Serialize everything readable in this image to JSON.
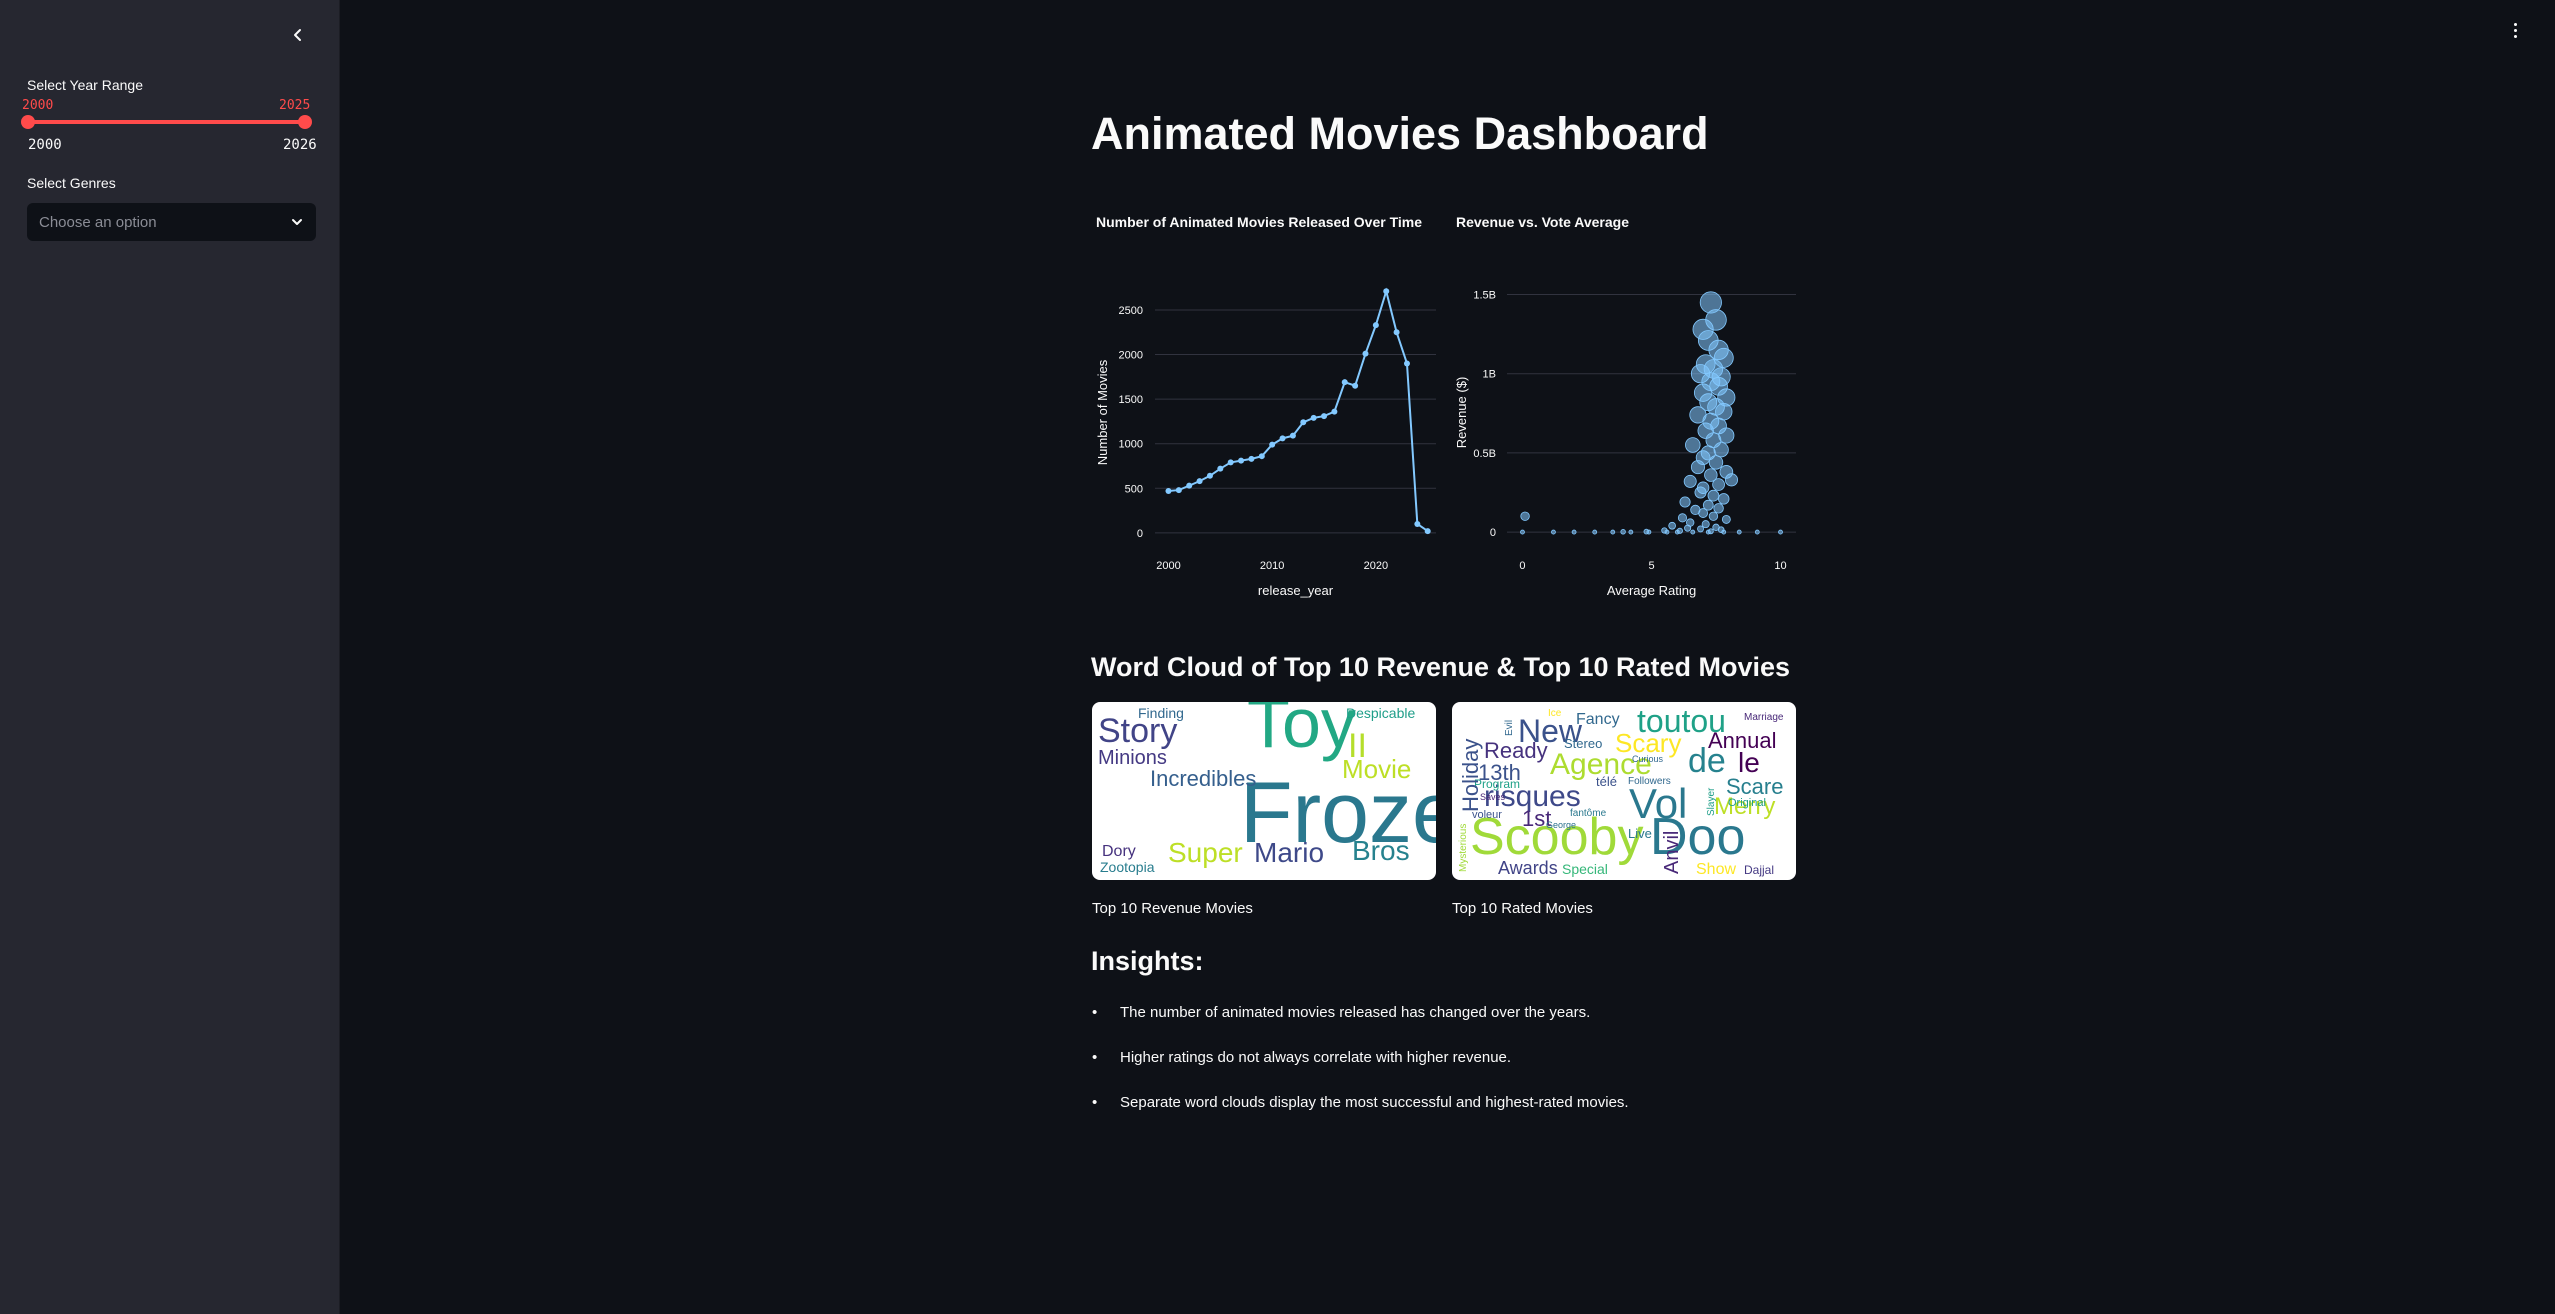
{
  "sidebar": {
    "year_range_label": "Select Year Range",
    "year_range": {
      "low": 2000,
      "high": 2025,
      "min": 2000,
      "max": 2026
    },
    "year_low_text": "2000",
    "year_high_text": "2025",
    "year_min_text": "2000",
    "year_max_text": "2026",
    "genres_label": "Select Genres",
    "genres_placeholder": "Choose an option"
  },
  "main": {
    "title": "Animated Movies Dashboard",
    "wordcloud_heading": "Word Cloud of Top 10 Revenue & Top 10 Rated Movies",
    "wordcloud_revenue_caption": "Top 10 Revenue Movies",
    "wordcloud_rated_caption": "Top 10 Rated Movies",
    "insights_title": "Insights:",
    "insights": [
      "The number of animated movies released has changed over the years.",
      "Higher ratings do not always correlate with higher revenue.",
      "Separate word clouds display the most successful and highest-rated movies."
    ]
  },
  "wordclouds": {
    "revenue": [
      "Toy",
      "Frozen",
      "Story",
      "Incredibles",
      "Minions",
      "Finding",
      "Despicable",
      "II",
      "Movie",
      "Super",
      "Mario",
      "Bros",
      "Dory",
      "Zootopia"
    ],
    "rated": [
      "Scooby",
      "Doo",
      "toutou",
      "New",
      "Fancy",
      "Scary",
      "Agence",
      "de",
      "le",
      "Vol",
      "risques",
      "Annual",
      "Ready",
      "13th",
      "Holiday",
      "Merry",
      "Scare",
      "Awards",
      "Special",
      "Show",
      "1st",
      "Anvil",
      "Stereo",
      "Live",
      "Marriage",
      "Followers",
      "Program",
      "Original",
      "Dajjal",
      "Mysterious",
      "télé",
      "George",
      "fantôme",
      "Curious",
      "voleur",
      "Saves",
      "Slayer",
      "Ice",
      "Evil"
    ]
  },
  "colors": {
    "accent": "#ff4b4b",
    "line": "#83c9ff",
    "background": "#0e1117",
    "sidebar": "#262730"
  },
  "icons": {
    "collapse": "chevron-left-icon",
    "menu": "more-vertical-icon",
    "dropdown": "chevron-down-icon"
  },
  "chart_data": [
    {
      "type": "line",
      "title": "Number of Animated Movies Released Over Time",
      "xlabel": "release_year",
      "ylabel": "Number of Movies",
      "x": [
        2000,
        2001,
        2002,
        2003,
        2004,
        2005,
        2006,
        2007,
        2008,
        2009,
        2010,
        2011,
        2012,
        2013,
        2014,
        2015,
        2016,
        2017,
        2018,
        2019,
        2020,
        2021,
        2022,
        2023,
        2024,
        2025
      ],
      "series": [
        {
          "values": [
            470,
            480,
            530,
            580,
            640,
            720,
            790,
            810,
            830,
            860,
            990,
            1060,
            1090,
            1240,
            1290,
            1310,
            1360,
            1690,
            1650,
            2010,
            2330,
            2710,
            2250,
            1900,
            100,
            20
          ]
        }
      ],
      "xticks": [
        2000,
        2010,
        2020
      ],
      "yticks": [
        0,
        500,
        1000,
        1500,
        2000,
        2500
      ],
      "xlim": [
        1998.7,
        2025.8
      ],
      "ylim": [
        -80,
        2780
      ],
      "grid": true
    },
    {
      "type": "scatter",
      "title": "Revenue vs. Vote Average",
      "xlabel": "Average Rating",
      "ylabel": "Revenue ($)",
      "xticks": [
        0,
        5,
        10
      ],
      "xtick_labels": [
        "0",
        "5",
        "10"
      ],
      "yticks": [
        0,
        500000000,
        1000000000,
        1500000000
      ],
      "ytick_labels": [
        "0",
        "0.5B",
        "1B",
        "1.5B"
      ],
      "xlim": [
        -0.6,
        10.6
      ],
      "ylim": [
        -50000000,
        1560000000
      ],
      "grid": true,
      "points": [
        [
          7.3,
          1450000000
        ],
        [
          7.5,
          1340000000
        ],
        [
          7.0,
          1280000000
        ],
        [
          7.2,
          1210000000
        ],
        [
          7.6,
          1150000000
        ],
        [
          7.8,
          1100000000
        ],
        [
          7.1,
          1060000000
        ],
        [
          7.4,
          1030000000
        ],
        [
          6.9,
          1000000000
        ],
        [
          7.7,
          980000000
        ],
        [
          7.3,
          950000000
        ],
        [
          7.6,
          920000000
        ],
        [
          7.0,
          880000000
        ],
        [
          7.9,
          850000000
        ],
        [
          7.2,
          820000000
        ],
        [
          7.5,
          790000000
        ],
        [
          7.8,
          760000000
        ],
        [
          6.8,
          740000000
        ],
        [
          7.3,
          700000000
        ],
        [
          7.6,
          670000000
        ],
        [
          7.1,
          640000000
        ],
        [
          7.9,
          610000000
        ],
        [
          7.4,
          580000000
        ],
        [
          6.6,
          550000000
        ],
        [
          7.7,
          520000000
        ],
        [
          7.2,
          500000000
        ],
        [
          7.0,
          470000000
        ],
        [
          7.5,
          440000000
        ],
        [
          6.8,
          410000000
        ],
        [
          7.9,
          380000000
        ],
        [
          8.1,
          330000000
        ],
        [
          7.3,
          360000000
        ],
        [
          6.5,
          320000000
        ],
        [
          7.6,
          300000000
        ],
        [
          7.0,
          280000000
        ],
        [
          6.9,
          250000000
        ],
        [
          7.4,
          230000000
        ],
        [
          7.8,
          210000000
        ],
        [
          6.3,
          190000000
        ],
        [
          7.2,
          170000000
        ],
        [
          7.6,
          150000000
        ],
        [
          6.7,
          140000000
        ],
        [
          7.0,
          120000000
        ],
        [
          7.4,
          100000000
        ],
        [
          6.2,
          90000000
        ],
        [
          7.9,
          80000000
        ],
        [
          6.5,
          60000000
        ],
        [
          7.1,
          50000000
        ],
        [
          5.8,
          40000000
        ],
        [
          7.5,
          30000000
        ],
        [
          6.4,
          25000000
        ],
        [
          6.9,
          20000000
        ],
        [
          7.7,
          15000000
        ],
        [
          5.5,
          10000000
        ],
        [
          6.1,
          8000000
        ],
        [
          7.3,
          5000000
        ],
        [
          4.8,
          3000000
        ],
        [
          3.9,
          2000000
        ],
        [
          0.0,
          0
        ],
        [
          1.2,
          0
        ],
        [
          2.0,
          0
        ],
        [
          2.8,
          0
        ],
        [
          3.5,
          0
        ],
        [
          4.2,
          0
        ],
        [
          4.9,
          0
        ],
        [
          5.6,
          0
        ],
        [
          6.0,
          0
        ],
        [
          6.6,
          0
        ],
        [
          7.2,
          0
        ],
        [
          7.8,
          0
        ],
        [
          8.4,
          0
        ],
        [
          9.1,
          0
        ],
        [
          10.0,
          0
        ],
        [
          0.1,
          100000000
        ]
      ]
    }
  ]
}
